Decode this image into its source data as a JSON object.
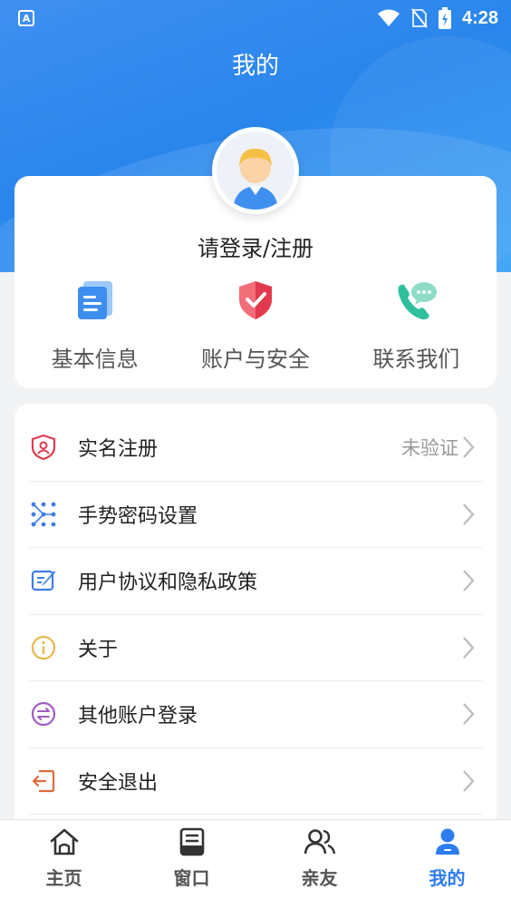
{
  "status_bar": {
    "app_badge": "A",
    "time": "4:28"
  },
  "header": {
    "title": "我的"
  },
  "profile": {
    "login_prompt": "请登录/注册",
    "quick_actions": [
      {
        "label": "基本信息",
        "icon": "document-icon"
      },
      {
        "label": "账户与安全",
        "icon": "shield-check-icon"
      },
      {
        "label": "联系我们",
        "icon": "phone-chat-icon"
      }
    ]
  },
  "menu": {
    "items": [
      {
        "label": "实名注册",
        "status": "未验证",
        "icon": "id-shield-icon"
      },
      {
        "label": "手势密码设置",
        "status": "",
        "icon": "gesture-grid-icon"
      },
      {
        "label": "用户协议和隐私政策",
        "status": "",
        "icon": "agreement-icon"
      },
      {
        "label": "关于",
        "status": "",
        "icon": "info-icon"
      },
      {
        "label": "其他账户登录",
        "status": "",
        "icon": "switch-account-icon"
      },
      {
        "label": "安全退出",
        "status": "",
        "icon": "logout-icon"
      }
    ]
  },
  "tab_bar": {
    "tabs": [
      {
        "label": "主页",
        "icon": "home-icon",
        "active": false
      },
      {
        "label": "窗口",
        "icon": "window-icon",
        "active": false
      },
      {
        "label": "亲友",
        "icon": "contacts-icon",
        "active": false
      },
      {
        "label": "我的",
        "icon": "user-icon",
        "active": true
      }
    ]
  },
  "colors": {
    "primary": "#2d7cf0",
    "header_gradient_start": "#3f8ff0",
    "header_gradient_end": "#2f9ef5"
  }
}
